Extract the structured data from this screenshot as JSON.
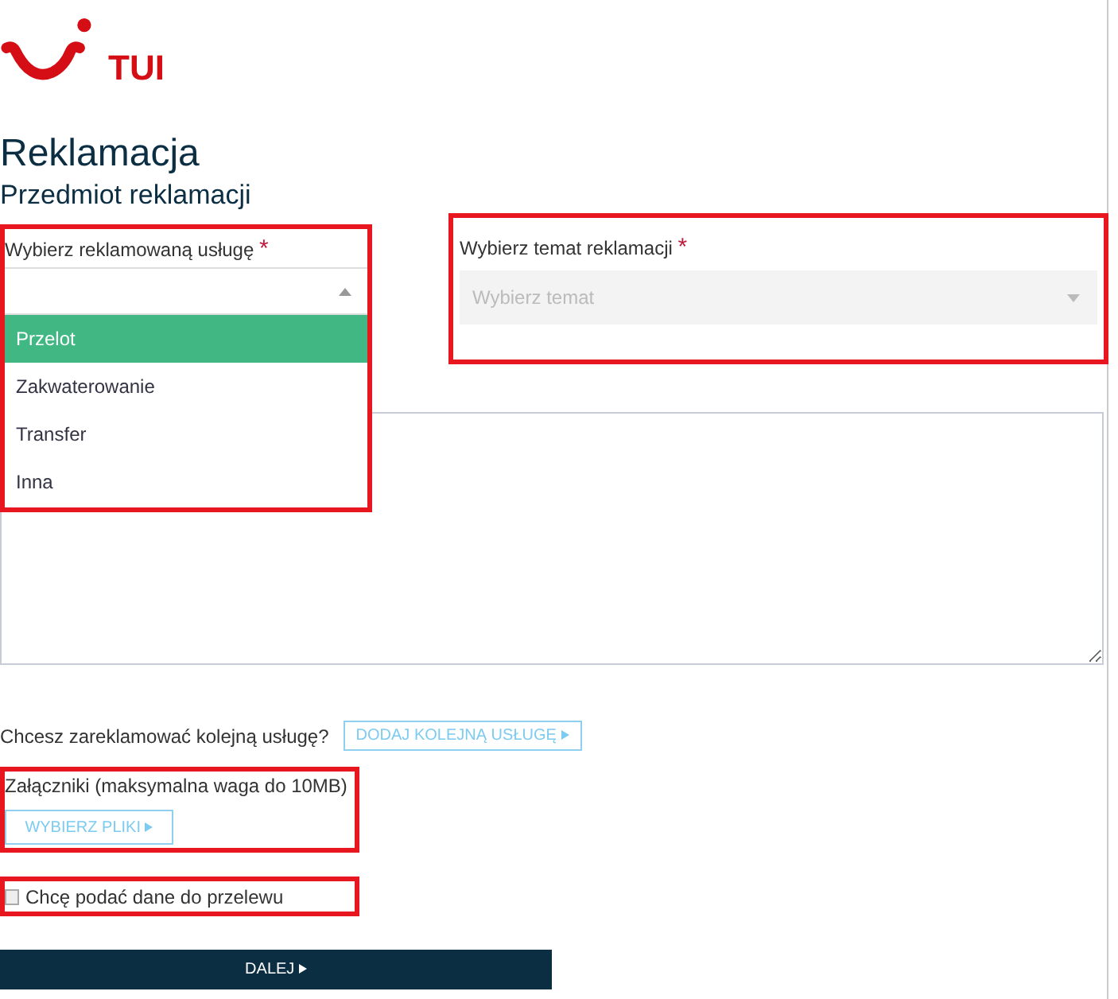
{
  "logo": {
    "text": "TUI"
  },
  "title": "Reklamacja",
  "subtitle": "Przedmiot reklamacji",
  "service_field": {
    "label": "Wybierz reklamowaną usługę",
    "required_mark": "*",
    "highlighted": true,
    "expanded": true,
    "options": [
      {
        "label": "Przelot",
        "selected": true
      },
      {
        "label": "Zakwaterowanie",
        "selected": false
      },
      {
        "label": "Transfer",
        "selected": false
      },
      {
        "label": "Inna",
        "selected": false
      }
    ]
  },
  "topic_field": {
    "label": "Wybierz temat reklamacji",
    "required_mark": "*",
    "placeholder": "Wybierz temat",
    "disabled": true,
    "highlighted": true
  },
  "another_service": {
    "question": "Chcesz zareklamować kolejną usługę?",
    "button": "DODAJ KOLEJNĄ USŁUGĘ"
  },
  "attachments": {
    "label": "Załączniki (maksymalna waga do 10MB)",
    "button": "WYBIERZ PLIKI",
    "highlighted": true
  },
  "bank_details": {
    "label": "Chcę podać dane do przelewu",
    "checked": false,
    "highlighted": true
  },
  "next_button": "DALEJ"
}
